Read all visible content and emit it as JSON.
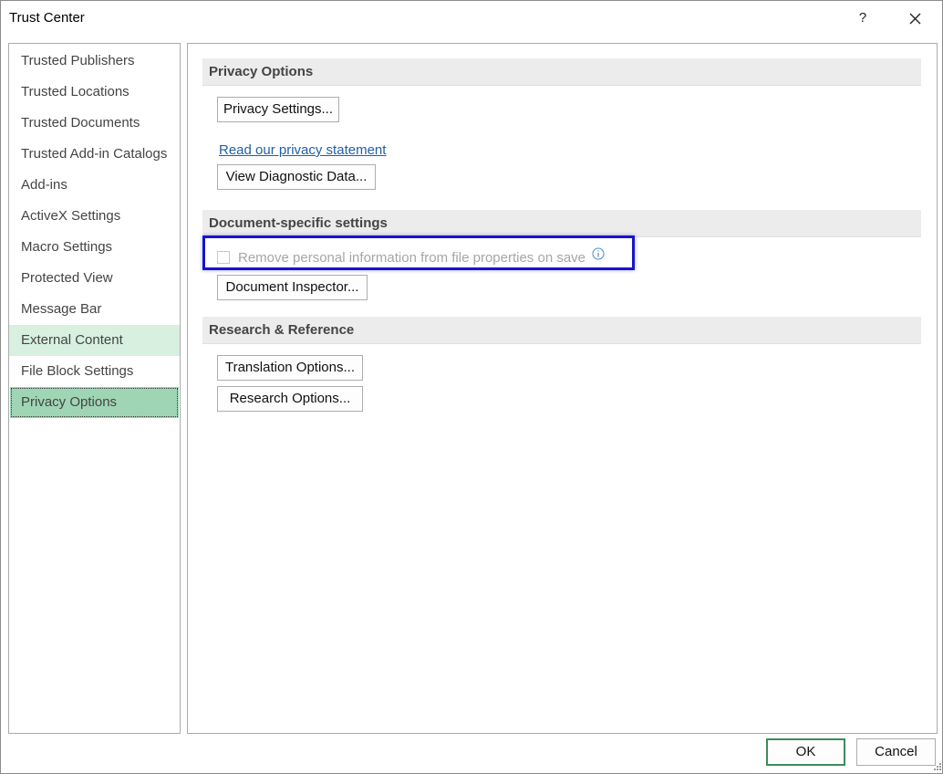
{
  "window": {
    "title": "Trust Center",
    "help_glyph": "?",
    "close_icon": "close-icon"
  },
  "sidebar": {
    "items": [
      {
        "label": "Trusted Publishers"
      },
      {
        "label": "Trusted Locations"
      },
      {
        "label": "Trusted Documents"
      },
      {
        "label": "Trusted Add-in Catalogs"
      },
      {
        "label": "Add-ins"
      },
      {
        "label": "ActiveX Settings"
      },
      {
        "label": "Macro Settings"
      },
      {
        "label": "Protected View"
      },
      {
        "label": "Message Bar"
      },
      {
        "label": "External Content",
        "state": "hover"
      },
      {
        "label": "File Block Settings"
      },
      {
        "label": "Privacy Options",
        "state": "selected"
      }
    ],
    "selected_color": "#9fd5b4",
    "hover_color": "#d8f0e0"
  },
  "privacy": {
    "header": "Privacy Options",
    "settings_button": "Privacy Settings...",
    "privacy_link": "Read our privacy statement",
    "diagnostic_button": "View Diagnostic Data..."
  },
  "document": {
    "header": "Document-specific settings",
    "remove_personal_info_label": "Remove personal information from file properties on save",
    "remove_personal_info_checked": false,
    "remove_personal_info_enabled": false,
    "inspector_button": "Document Inspector..."
  },
  "research": {
    "header": "Research & Reference",
    "translation_button": "Translation Options...",
    "research_button": "Research Options..."
  },
  "footer": {
    "ok_label": "OK",
    "cancel_label": "Cancel"
  },
  "colors": {
    "highlight_border": "#1616c8",
    "link": "#1f5fa8",
    "ok_border": "#3c8c5c"
  }
}
